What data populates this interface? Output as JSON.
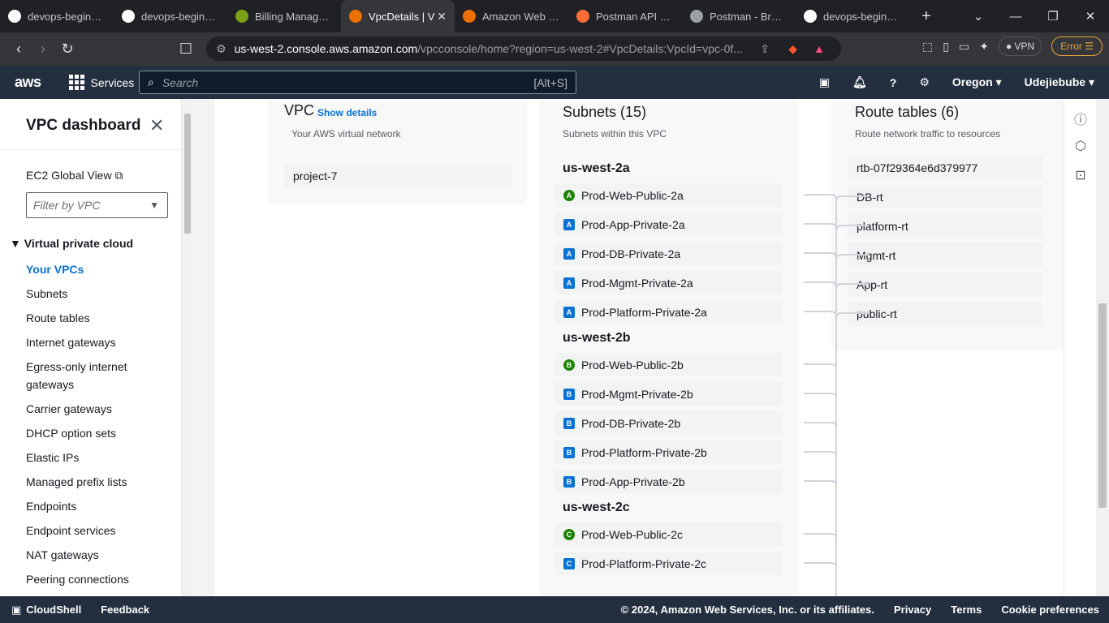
{
  "browser": {
    "tabs": [
      {
        "label": "devops-beginner",
        "icon": "github-icon",
        "color": "#ffffff"
      },
      {
        "label": "devops-beginner",
        "icon": "github-icon",
        "color": "#ffffff"
      },
      {
        "label": "Billing Manageme",
        "icon": "billing-icon",
        "color": "#7aa116"
      },
      {
        "label": "VpcDetails | V",
        "icon": "aws-vpc-icon",
        "color": "#ed7100",
        "active": true
      },
      {
        "label": "Amazon Web Ser",
        "icon": "aws-icon",
        "color": "#ed7100"
      },
      {
        "label": "Postman API Plat",
        "icon": "postman-icon",
        "color": "#ff6c37"
      },
      {
        "label": "Postman - Brows",
        "icon": "globe-icon",
        "color": "#9aa0a6"
      },
      {
        "label": "devops-beginner",
        "icon": "github-icon",
        "color": "#ffffff"
      }
    ],
    "url_host": "us-west-2.console.aws.amazon.com",
    "url_path": "/vpcconsole/home?region=us-west-2#VpcDetails:VpcId=vpc-0f...",
    "vpn_label": "VPN",
    "error_label": "Error"
  },
  "aws_nav": {
    "logo": "aws",
    "services_label": "Services",
    "search_placeholder": "Search",
    "search_shortcut": "[Alt+S]",
    "region": "Oregon",
    "user": "Udejiebube"
  },
  "sidebar": {
    "title": "VPC dashboard",
    "ec2_global_view": "EC2 Global View",
    "filter_placeholder": "Filter by VPC",
    "section": "Virtual private cloud",
    "items": [
      {
        "label": "Your VPCs",
        "active": true
      },
      {
        "label": "Subnets"
      },
      {
        "label": "Route tables"
      },
      {
        "label": "Internet gateways"
      },
      {
        "label": "Egress-only internet gateways"
      },
      {
        "label": "Carrier gateways"
      },
      {
        "label": "DHCP option sets"
      },
      {
        "label": "Elastic IPs"
      },
      {
        "label": "Managed prefix lists"
      },
      {
        "label": "Endpoints"
      },
      {
        "label": "Endpoint services"
      },
      {
        "label": "NAT gateways"
      },
      {
        "label": "Peering connections"
      }
    ]
  },
  "resource_map": {
    "vpc": {
      "title": "VPC",
      "show_details": "Show details",
      "subtitle": "Your AWS virtual network",
      "name": "project-7"
    },
    "subnets": {
      "title": "Subnets (15)",
      "subtitle": "Subnets within this VPC",
      "groups": [
        {
          "az": "us-west-2a",
          "items": [
            {
              "name": "Prod-Web-Public-2a",
              "badge": "A",
              "public": true
            },
            {
              "name": "Prod-App-Private-2a",
              "badge": "A",
              "public": false
            },
            {
              "name": "Prod-DB-Private-2a",
              "badge": "A",
              "public": false
            },
            {
              "name": "Prod-Mgmt-Private-2a",
              "badge": "A",
              "public": false
            },
            {
              "name": "Prod-Platform-Private-2a",
              "badge": "A",
              "public": false
            }
          ]
        },
        {
          "az": "us-west-2b",
          "items": [
            {
              "name": "Prod-Web-Public-2b",
              "badge": "B",
              "public": true
            },
            {
              "name": "Prod-Mgmt-Private-2b",
              "badge": "B",
              "public": false
            },
            {
              "name": "Prod-DB-Private-2b",
              "badge": "B",
              "public": false
            },
            {
              "name": "Prod-Platform-Private-2b",
              "badge": "B",
              "public": false
            },
            {
              "name": "Prod-App-Private-2b",
              "badge": "B",
              "public": false
            }
          ]
        },
        {
          "az": "us-west-2c",
          "items": [
            {
              "name": "Prod-Web-Public-2c",
              "badge": "C",
              "public": true
            },
            {
              "name": "Prod-Platform-Private-2c",
              "badge": "C",
              "public": false
            }
          ]
        }
      ]
    },
    "route_tables": {
      "title": "Route tables (6)",
      "subtitle": "Route network traffic to resources",
      "items": [
        "rtb-07f29364e6d379977",
        "DB-rt",
        "platform-rt",
        "Mgmt-rt",
        "App-rt",
        "public-rt"
      ]
    }
  },
  "footer": {
    "cloudshell": "CloudShell",
    "feedback": "Feedback",
    "copyright": "© 2024, Amazon Web Services, Inc. or its affiliates.",
    "privacy": "Privacy",
    "terms": "Terms",
    "cookies": "Cookie preferences"
  },
  "colors": {
    "aws_nav_bg": "#232f3e",
    "link_blue": "#0972d3",
    "public_green": "#1d8102"
  }
}
